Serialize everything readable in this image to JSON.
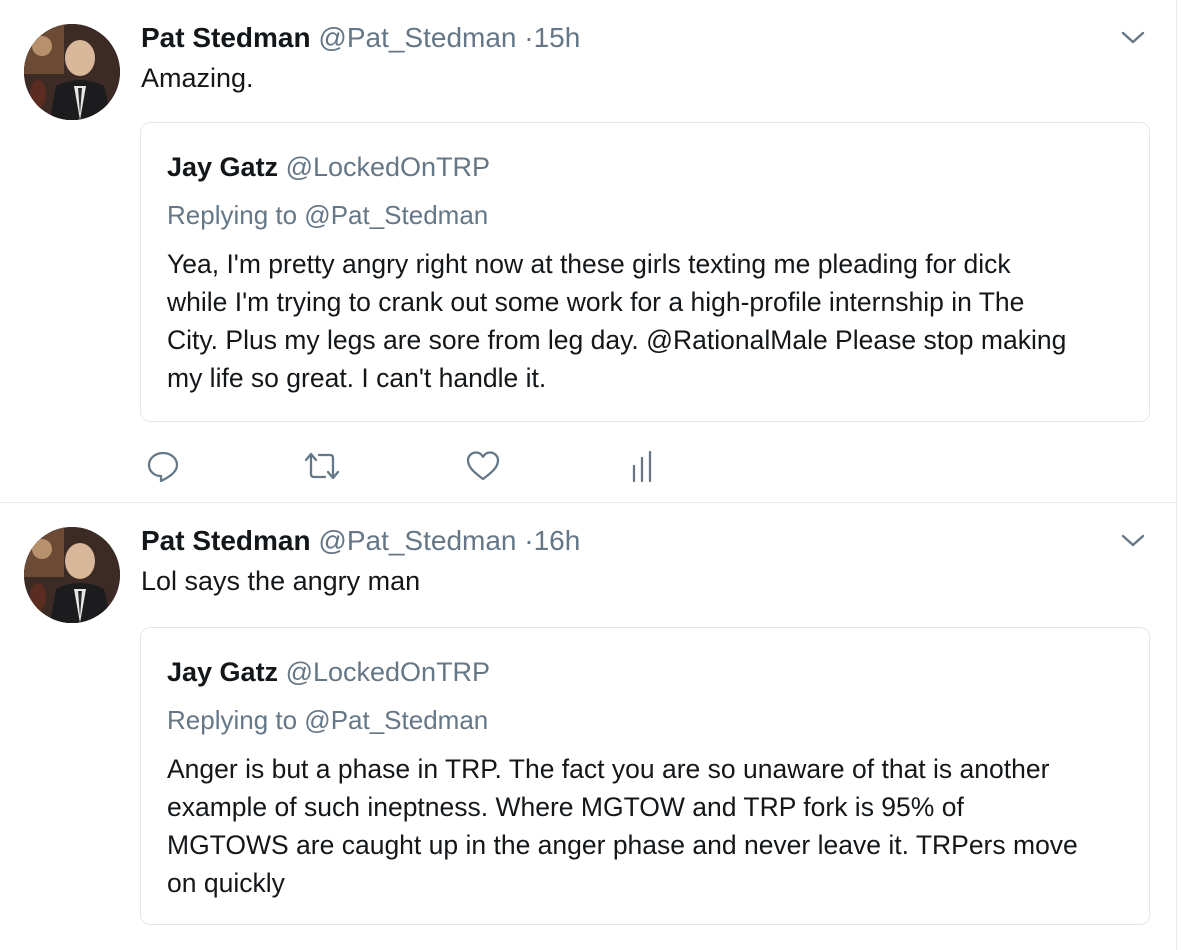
{
  "tweets": [
    {
      "author": {
        "name": "Pat Stedman",
        "handle": "@Pat_Stedman",
        "time": "15h"
      },
      "separator": "·",
      "text": "Amazing.",
      "quote": {
        "author": {
          "name": "Jay Gatz",
          "handle": "@LockedOnTRP"
        },
        "replying": "Replying to @Pat_Stedman",
        "lines": [
          "Yea, I'm pretty angry right now at these girls texting me pleading for dick",
          "while I'm trying to crank out some work for a high-profile internship in The",
          "City. Plus my legs are sore from leg day. @RationalMale Please stop making",
          "my life so great. I can't handle it."
        ]
      },
      "actions": {
        "icons": [
          "reply-icon",
          "retweet-icon",
          "like-icon",
          "analytics-icon"
        ]
      }
    },
    {
      "author": {
        "name": "Pat Stedman",
        "handle": "@Pat_Stedman",
        "time": "16h"
      },
      "separator": "·",
      "text": "Lol says the angry man",
      "quote": {
        "author": {
          "name": "Jay Gatz",
          "handle": "@LockedOnTRP"
        },
        "replying": "Replying to @Pat_Stedman",
        "lines": [
          "Anger is but a phase in TRP. The fact you are so unaware of that is another",
          "example of such ineptness. Where MGTOW and TRP fork is 95% of",
          "MGTOWS are caught up in the anger phase and never leave it. TRPers move",
          "on quickly"
        ]
      }
    }
  ],
  "colors": {
    "text": "#14171a",
    "secondary": "#657786",
    "border": "#e1e8ed",
    "icon": "#657786"
  }
}
